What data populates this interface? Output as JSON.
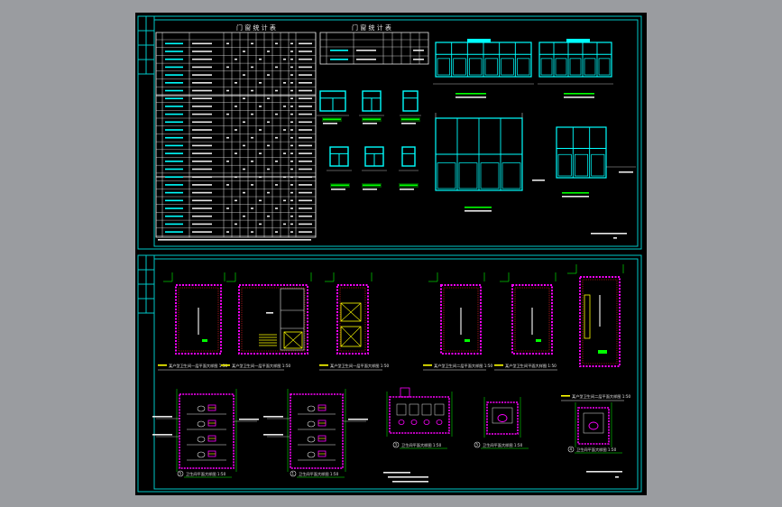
{
  "viewport": {
    "background": "#9a9ca0",
    "canvas": "#000000"
  },
  "colors": {
    "frame": "#00c8c8",
    "cyan": "#00ffff",
    "white": "#e8e8e8",
    "magenta": "#ff00ff",
    "green": "#00ff00",
    "yellow": "#ffff00",
    "red": "#ff2020"
  },
  "sheet_top": {
    "schedule_title_1": "门 窗 统 计 表",
    "schedule_title_2": "门 窗 统 计 表"
  },
  "sheet_bottom": {
    "plans": [
      {
        "title": "某户型卫生间一层平面大样图",
        "scale": "1:50"
      },
      {
        "title": "某户型卫生间一层平面大样图",
        "scale": "1:50"
      },
      {
        "title": "某户型卫生间一层平面大样图",
        "scale": "1:50"
      },
      {
        "title": "某户型卫生间二层平面大样图",
        "scale": "1:50"
      },
      {
        "title": "某户型卫生间平面大样图",
        "scale": "1:50"
      },
      {
        "title": "某户型卫生间二层平面大样图",
        "scale": "1:50"
      }
    ],
    "details": [
      {
        "num": "5",
        "title": "卫生间平面大样图",
        "scale": "1:50"
      },
      {
        "num": "1",
        "title": "卫生间平面大样图",
        "scale": "1:50"
      },
      {
        "num": "3",
        "title": "卫生间平面大样图",
        "scale": "1:50"
      },
      {
        "num": "5",
        "title": "卫生间平面大样图",
        "scale": "1:50"
      },
      {
        "num": "4",
        "title": "卫生间平面大样图",
        "scale": "1:50"
      }
    ]
  }
}
